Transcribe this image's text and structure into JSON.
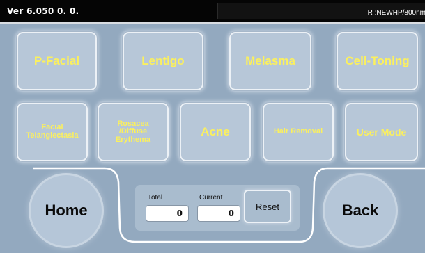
{
  "header": {
    "version": "Ver 6.050 0. 0.",
    "model": "R :NEWHP/800nm"
  },
  "modes": {
    "row1": [
      "P-Facial",
      "Lentigo",
      "Melasma",
      "Cell-Toning"
    ],
    "facial_telangiectasia": [
      "Facial",
      "Telangiectasia"
    ],
    "rosacea": [
      "Rosacea",
      "/Diffuse",
      "Erythema"
    ],
    "acne": "Acne",
    "hair_removal": "Hair Removal",
    "user_mode": "User Mode"
  },
  "nav": {
    "home_label": "Home",
    "back_label": "Back"
  },
  "counter": {
    "total_label": "Total",
    "total_value": "0",
    "current_label": "Current",
    "current_value": "0",
    "reset_label": "Reset"
  },
  "colors": {
    "background": "#93a9bf",
    "button_text": "#fbf05e",
    "topbar": "#050505"
  }
}
